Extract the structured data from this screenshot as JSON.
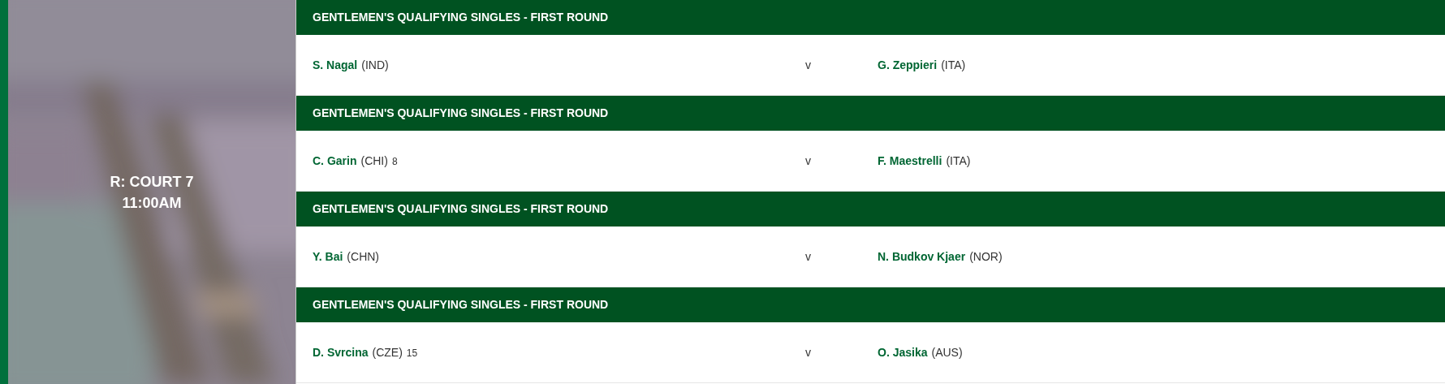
{
  "court": {
    "name": "R: COURT 7",
    "time": "11:00AM"
  },
  "matches": [
    {
      "round": "GENTLEMEN'S QUALIFYING SINGLES - FIRST ROUND",
      "player1": {
        "name": "S. Nagal",
        "country": "(IND)"
      },
      "versus": "v",
      "player2": {
        "name": "G. Zeppieri",
        "country": "(ITA)"
      }
    },
    {
      "round": "GENTLEMEN'S QUALIFYING SINGLES - FIRST ROUND",
      "player1": {
        "name": "C. Garin",
        "country": "(CHI)",
        "seed": "8"
      },
      "versus": "v",
      "player2": {
        "name": "F. Maestrelli",
        "country": "(ITA)"
      }
    },
    {
      "round": "GENTLEMEN'S QUALIFYING SINGLES - FIRST ROUND",
      "player1": {
        "name": "Y. Bai",
        "country": "(CHN)"
      },
      "versus": "v",
      "player2": {
        "name": "N. Budkov Kjaer",
        "country": "(NOR)"
      }
    },
    {
      "round": "GENTLEMEN'S QUALIFYING SINGLES - FIRST ROUND",
      "player1": {
        "name": "D. Svrcina",
        "country": "(CZE)",
        "seed": "15"
      },
      "versus": "v",
      "player2": {
        "name": "O. Jasika",
        "country": "(AUS)"
      }
    }
  ]
}
